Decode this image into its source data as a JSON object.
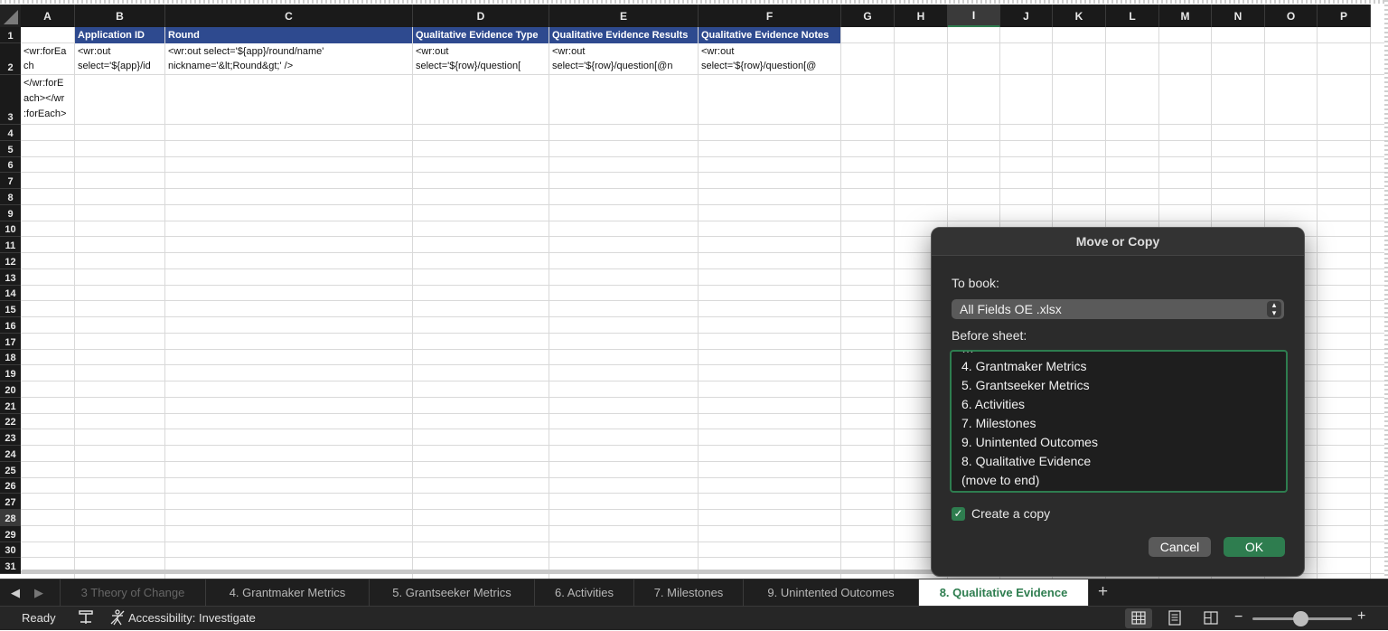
{
  "columns": [
    "A",
    "B",
    "C",
    "D",
    "E",
    "F",
    "G",
    "H",
    "I",
    "J",
    "K",
    "L",
    "M",
    "N",
    "O",
    "P"
  ],
  "selected_column": "I",
  "rows": [
    "1",
    "2",
    "3",
    "4",
    "5",
    "6",
    "7",
    "8",
    "9",
    "10",
    "11",
    "12",
    "13",
    "14",
    "15",
    "16",
    "17",
    "18",
    "19",
    "20",
    "21",
    "22",
    "23",
    "24",
    "25",
    "26",
    "27",
    "28",
    "29",
    "30",
    "31"
  ],
  "selected_row": "28",
  "header_row": {
    "B": "Application ID",
    "C": "Round",
    "D": "Qualitative Evidence Type",
    "E": "Qualitative Evidence Results",
    "F": "Qualitative Evidence Notes"
  },
  "cells": {
    "A2_line1": "<wr:forEa",
    "A2_line2": "ch",
    "A3_line1": "</wr:forE",
    "A3_line2": "ach></wr",
    "A3_line3": ":forEach>",
    "B2_line1": "<wr:out",
    "B2_line2": "select='${app}/id",
    "C2_line1": "<wr:out select='${app}/round/name'",
    "C2_line2": "nickname='&lt;Round&gt;' />",
    "D2_line1": "<wr:out",
    "D2_line2": "select='${row}/question[",
    "E2_line1": "<wr:out",
    "E2_line2": "select='${row}/question[@n",
    "F2_line1": "<wr:out",
    "F2_line2": "select='${row}/question[@"
  },
  "dialog": {
    "title": "Move or Copy",
    "to_book_label": "To book:",
    "book_value": "All Fields OE .xlsx",
    "before_sheet_label": "Before sheet:",
    "sheets": [
      "4. Grantmaker Metrics",
      "5. Grantseeker Metrics",
      "6. Activities",
      "7. Milestones",
      "9. Unintented Outcomes",
      "8. Qualitative Evidence",
      "(move to end)"
    ],
    "create_copy_label": "Create a copy",
    "create_copy_checked": true,
    "cancel_label": "Cancel",
    "ok_label": "OK"
  },
  "tabs": [
    "3 Theory of Change",
    "4. Grantmaker Metrics",
    "5. Grantseeker Metrics",
    "6. Activities",
    "7. Milestones",
    "9. Unintented Outcomes",
    "8. Qualitative Evidence"
  ],
  "active_tab": "8. Qualitative Evidence",
  "add_tab_label": "+",
  "status": {
    "ready": "Ready",
    "accessibility": "Accessibility: Investigate",
    "zoom_minus": "−",
    "zoom_plus": "+"
  },
  "colors": {
    "accent_green": "#2e7d4f",
    "header_blue": "#2e4a8f"
  }
}
